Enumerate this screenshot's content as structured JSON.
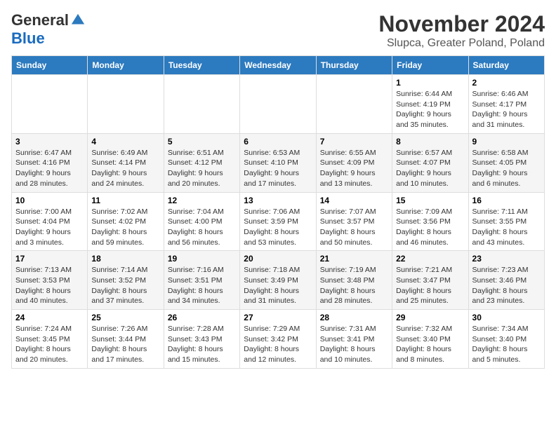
{
  "logo": {
    "general": "General",
    "blue": "Blue"
  },
  "title": "November 2024",
  "subtitle": "Slupca, Greater Poland, Poland",
  "days_of_week": [
    "Sunday",
    "Monday",
    "Tuesday",
    "Wednesday",
    "Thursday",
    "Friday",
    "Saturday"
  ],
  "weeks": [
    [
      {
        "day": "",
        "detail": ""
      },
      {
        "day": "",
        "detail": ""
      },
      {
        "day": "",
        "detail": ""
      },
      {
        "day": "",
        "detail": ""
      },
      {
        "day": "",
        "detail": ""
      },
      {
        "day": "1",
        "detail": "Sunrise: 6:44 AM\nSunset: 4:19 PM\nDaylight: 9 hours and 35 minutes."
      },
      {
        "day": "2",
        "detail": "Sunrise: 6:46 AM\nSunset: 4:17 PM\nDaylight: 9 hours and 31 minutes."
      }
    ],
    [
      {
        "day": "3",
        "detail": "Sunrise: 6:47 AM\nSunset: 4:16 PM\nDaylight: 9 hours and 28 minutes."
      },
      {
        "day": "4",
        "detail": "Sunrise: 6:49 AM\nSunset: 4:14 PM\nDaylight: 9 hours and 24 minutes."
      },
      {
        "day": "5",
        "detail": "Sunrise: 6:51 AM\nSunset: 4:12 PM\nDaylight: 9 hours and 20 minutes."
      },
      {
        "day": "6",
        "detail": "Sunrise: 6:53 AM\nSunset: 4:10 PM\nDaylight: 9 hours and 17 minutes."
      },
      {
        "day": "7",
        "detail": "Sunrise: 6:55 AM\nSunset: 4:09 PM\nDaylight: 9 hours and 13 minutes."
      },
      {
        "day": "8",
        "detail": "Sunrise: 6:57 AM\nSunset: 4:07 PM\nDaylight: 9 hours and 10 minutes."
      },
      {
        "day": "9",
        "detail": "Sunrise: 6:58 AM\nSunset: 4:05 PM\nDaylight: 9 hours and 6 minutes."
      }
    ],
    [
      {
        "day": "10",
        "detail": "Sunrise: 7:00 AM\nSunset: 4:04 PM\nDaylight: 9 hours and 3 minutes."
      },
      {
        "day": "11",
        "detail": "Sunrise: 7:02 AM\nSunset: 4:02 PM\nDaylight: 8 hours and 59 minutes."
      },
      {
        "day": "12",
        "detail": "Sunrise: 7:04 AM\nSunset: 4:00 PM\nDaylight: 8 hours and 56 minutes."
      },
      {
        "day": "13",
        "detail": "Sunrise: 7:06 AM\nSunset: 3:59 PM\nDaylight: 8 hours and 53 minutes."
      },
      {
        "day": "14",
        "detail": "Sunrise: 7:07 AM\nSunset: 3:57 PM\nDaylight: 8 hours and 50 minutes."
      },
      {
        "day": "15",
        "detail": "Sunrise: 7:09 AM\nSunset: 3:56 PM\nDaylight: 8 hours and 46 minutes."
      },
      {
        "day": "16",
        "detail": "Sunrise: 7:11 AM\nSunset: 3:55 PM\nDaylight: 8 hours and 43 minutes."
      }
    ],
    [
      {
        "day": "17",
        "detail": "Sunrise: 7:13 AM\nSunset: 3:53 PM\nDaylight: 8 hours and 40 minutes."
      },
      {
        "day": "18",
        "detail": "Sunrise: 7:14 AM\nSunset: 3:52 PM\nDaylight: 8 hours and 37 minutes."
      },
      {
        "day": "19",
        "detail": "Sunrise: 7:16 AM\nSunset: 3:51 PM\nDaylight: 8 hours and 34 minutes."
      },
      {
        "day": "20",
        "detail": "Sunrise: 7:18 AM\nSunset: 3:49 PM\nDaylight: 8 hours and 31 minutes."
      },
      {
        "day": "21",
        "detail": "Sunrise: 7:19 AM\nSunset: 3:48 PM\nDaylight: 8 hours and 28 minutes."
      },
      {
        "day": "22",
        "detail": "Sunrise: 7:21 AM\nSunset: 3:47 PM\nDaylight: 8 hours and 25 minutes."
      },
      {
        "day": "23",
        "detail": "Sunrise: 7:23 AM\nSunset: 3:46 PM\nDaylight: 8 hours and 23 minutes."
      }
    ],
    [
      {
        "day": "24",
        "detail": "Sunrise: 7:24 AM\nSunset: 3:45 PM\nDaylight: 8 hours and 20 minutes."
      },
      {
        "day": "25",
        "detail": "Sunrise: 7:26 AM\nSunset: 3:44 PM\nDaylight: 8 hours and 17 minutes."
      },
      {
        "day": "26",
        "detail": "Sunrise: 7:28 AM\nSunset: 3:43 PM\nDaylight: 8 hours and 15 minutes."
      },
      {
        "day": "27",
        "detail": "Sunrise: 7:29 AM\nSunset: 3:42 PM\nDaylight: 8 hours and 12 minutes."
      },
      {
        "day": "28",
        "detail": "Sunrise: 7:31 AM\nSunset: 3:41 PM\nDaylight: 8 hours and 10 minutes."
      },
      {
        "day": "29",
        "detail": "Sunrise: 7:32 AM\nSunset: 3:40 PM\nDaylight: 8 hours and 8 minutes."
      },
      {
        "day": "30",
        "detail": "Sunrise: 7:34 AM\nSunset: 3:40 PM\nDaylight: 8 hours and 5 minutes."
      }
    ]
  ]
}
